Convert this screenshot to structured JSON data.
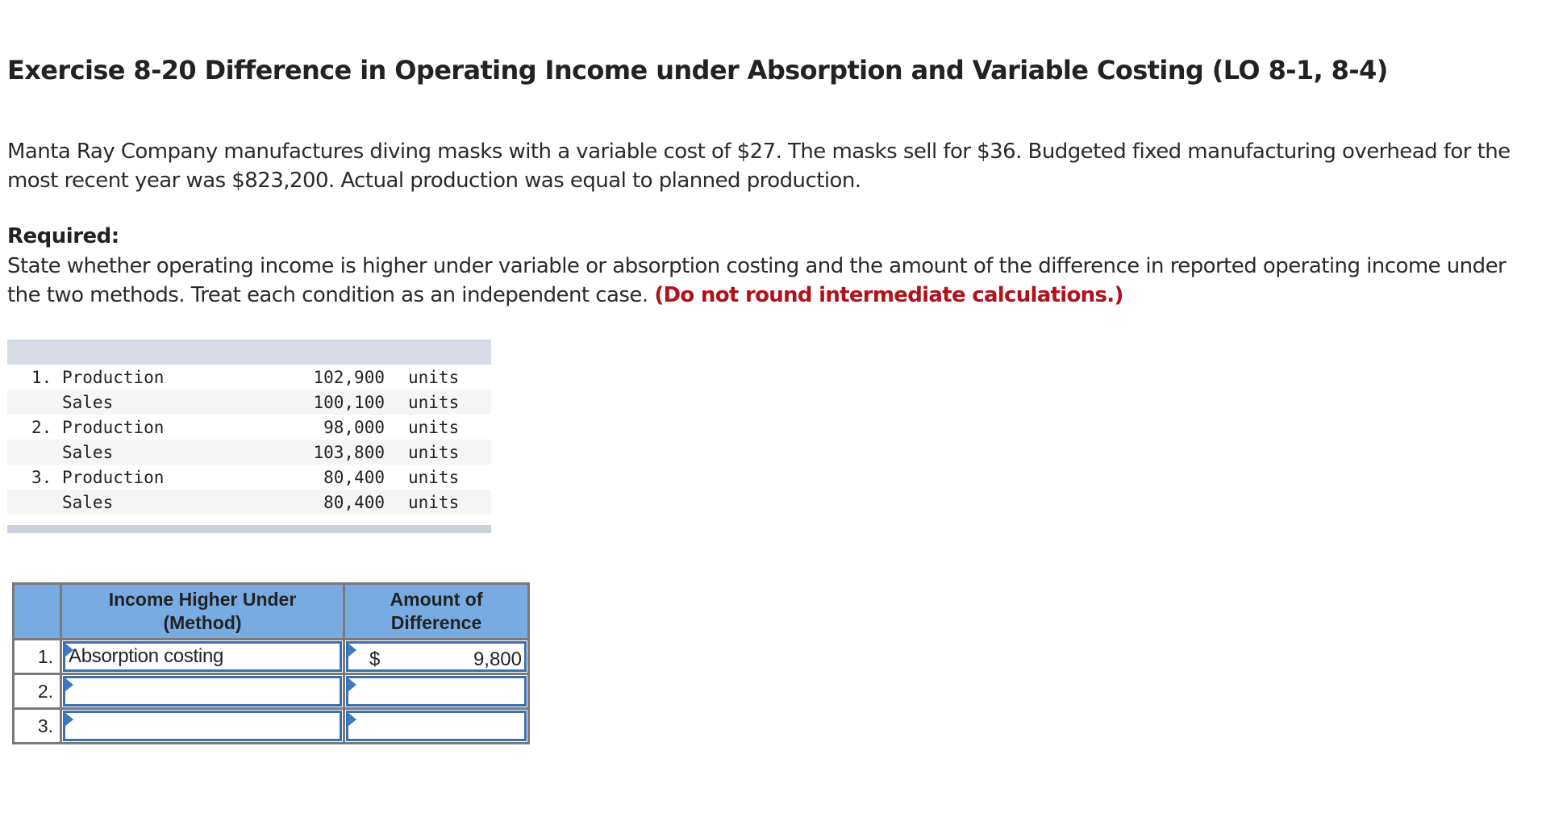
{
  "title": "Exercise 8-20 Difference in Operating Income under Absorption and Variable Costing (LO 8-1, 8-4)",
  "intro": "Manta Ray Company manufactures diving masks with a variable cost of $27. The masks sell for $36. Budgeted fixed manufacturing overhead for the most recent year was $823,200. Actual production was equal to planned production.",
  "required_label": "Required:",
  "required_text": "State whether operating income is higher under variable or absorption costing and the amount of the difference in reported operating income under the two methods. Treat each condition as an independent case.",
  "required_note": "(Do not round intermediate calculations.)",
  "given": {
    "rows": [
      {
        "num": "1.",
        "label": "Production",
        "value": "102,900",
        "unit": "units"
      },
      {
        "num": "",
        "label": "Sales",
        "value": "100,100",
        "unit": "units"
      },
      {
        "num": "2.",
        "label": "Production",
        "value": "98,000",
        "unit": "units"
      },
      {
        "num": "",
        "label": "Sales",
        "value": "103,800",
        "unit": "units"
      },
      {
        "num": "3.",
        "label": "Production",
        "value": "80,400",
        "unit": "units"
      },
      {
        "num": "",
        "label": "Sales",
        "value": "80,400",
        "unit": "units"
      }
    ]
  },
  "answer": {
    "headers": [
      "",
      "Income Higher Under (Method)",
      "Amount of Difference"
    ],
    "header_line1": [
      "Income Higher Under",
      "Amount of"
    ],
    "header_line2": [
      "(Method)",
      "Difference"
    ],
    "rows": [
      {
        "num": "1.",
        "method": "Absorption costing",
        "currency": "$",
        "amount": "9,800"
      },
      {
        "num": "2.",
        "method": "",
        "currency": "",
        "amount": ""
      },
      {
        "num": "3.",
        "method": "",
        "currency": "",
        "amount": ""
      }
    ]
  },
  "colors": {
    "warning_text": "#b0121b",
    "answer_header_bg": "#79abe3",
    "input_border": "#3d6fae",
    "band": "#d6dbe5"
  }
}
